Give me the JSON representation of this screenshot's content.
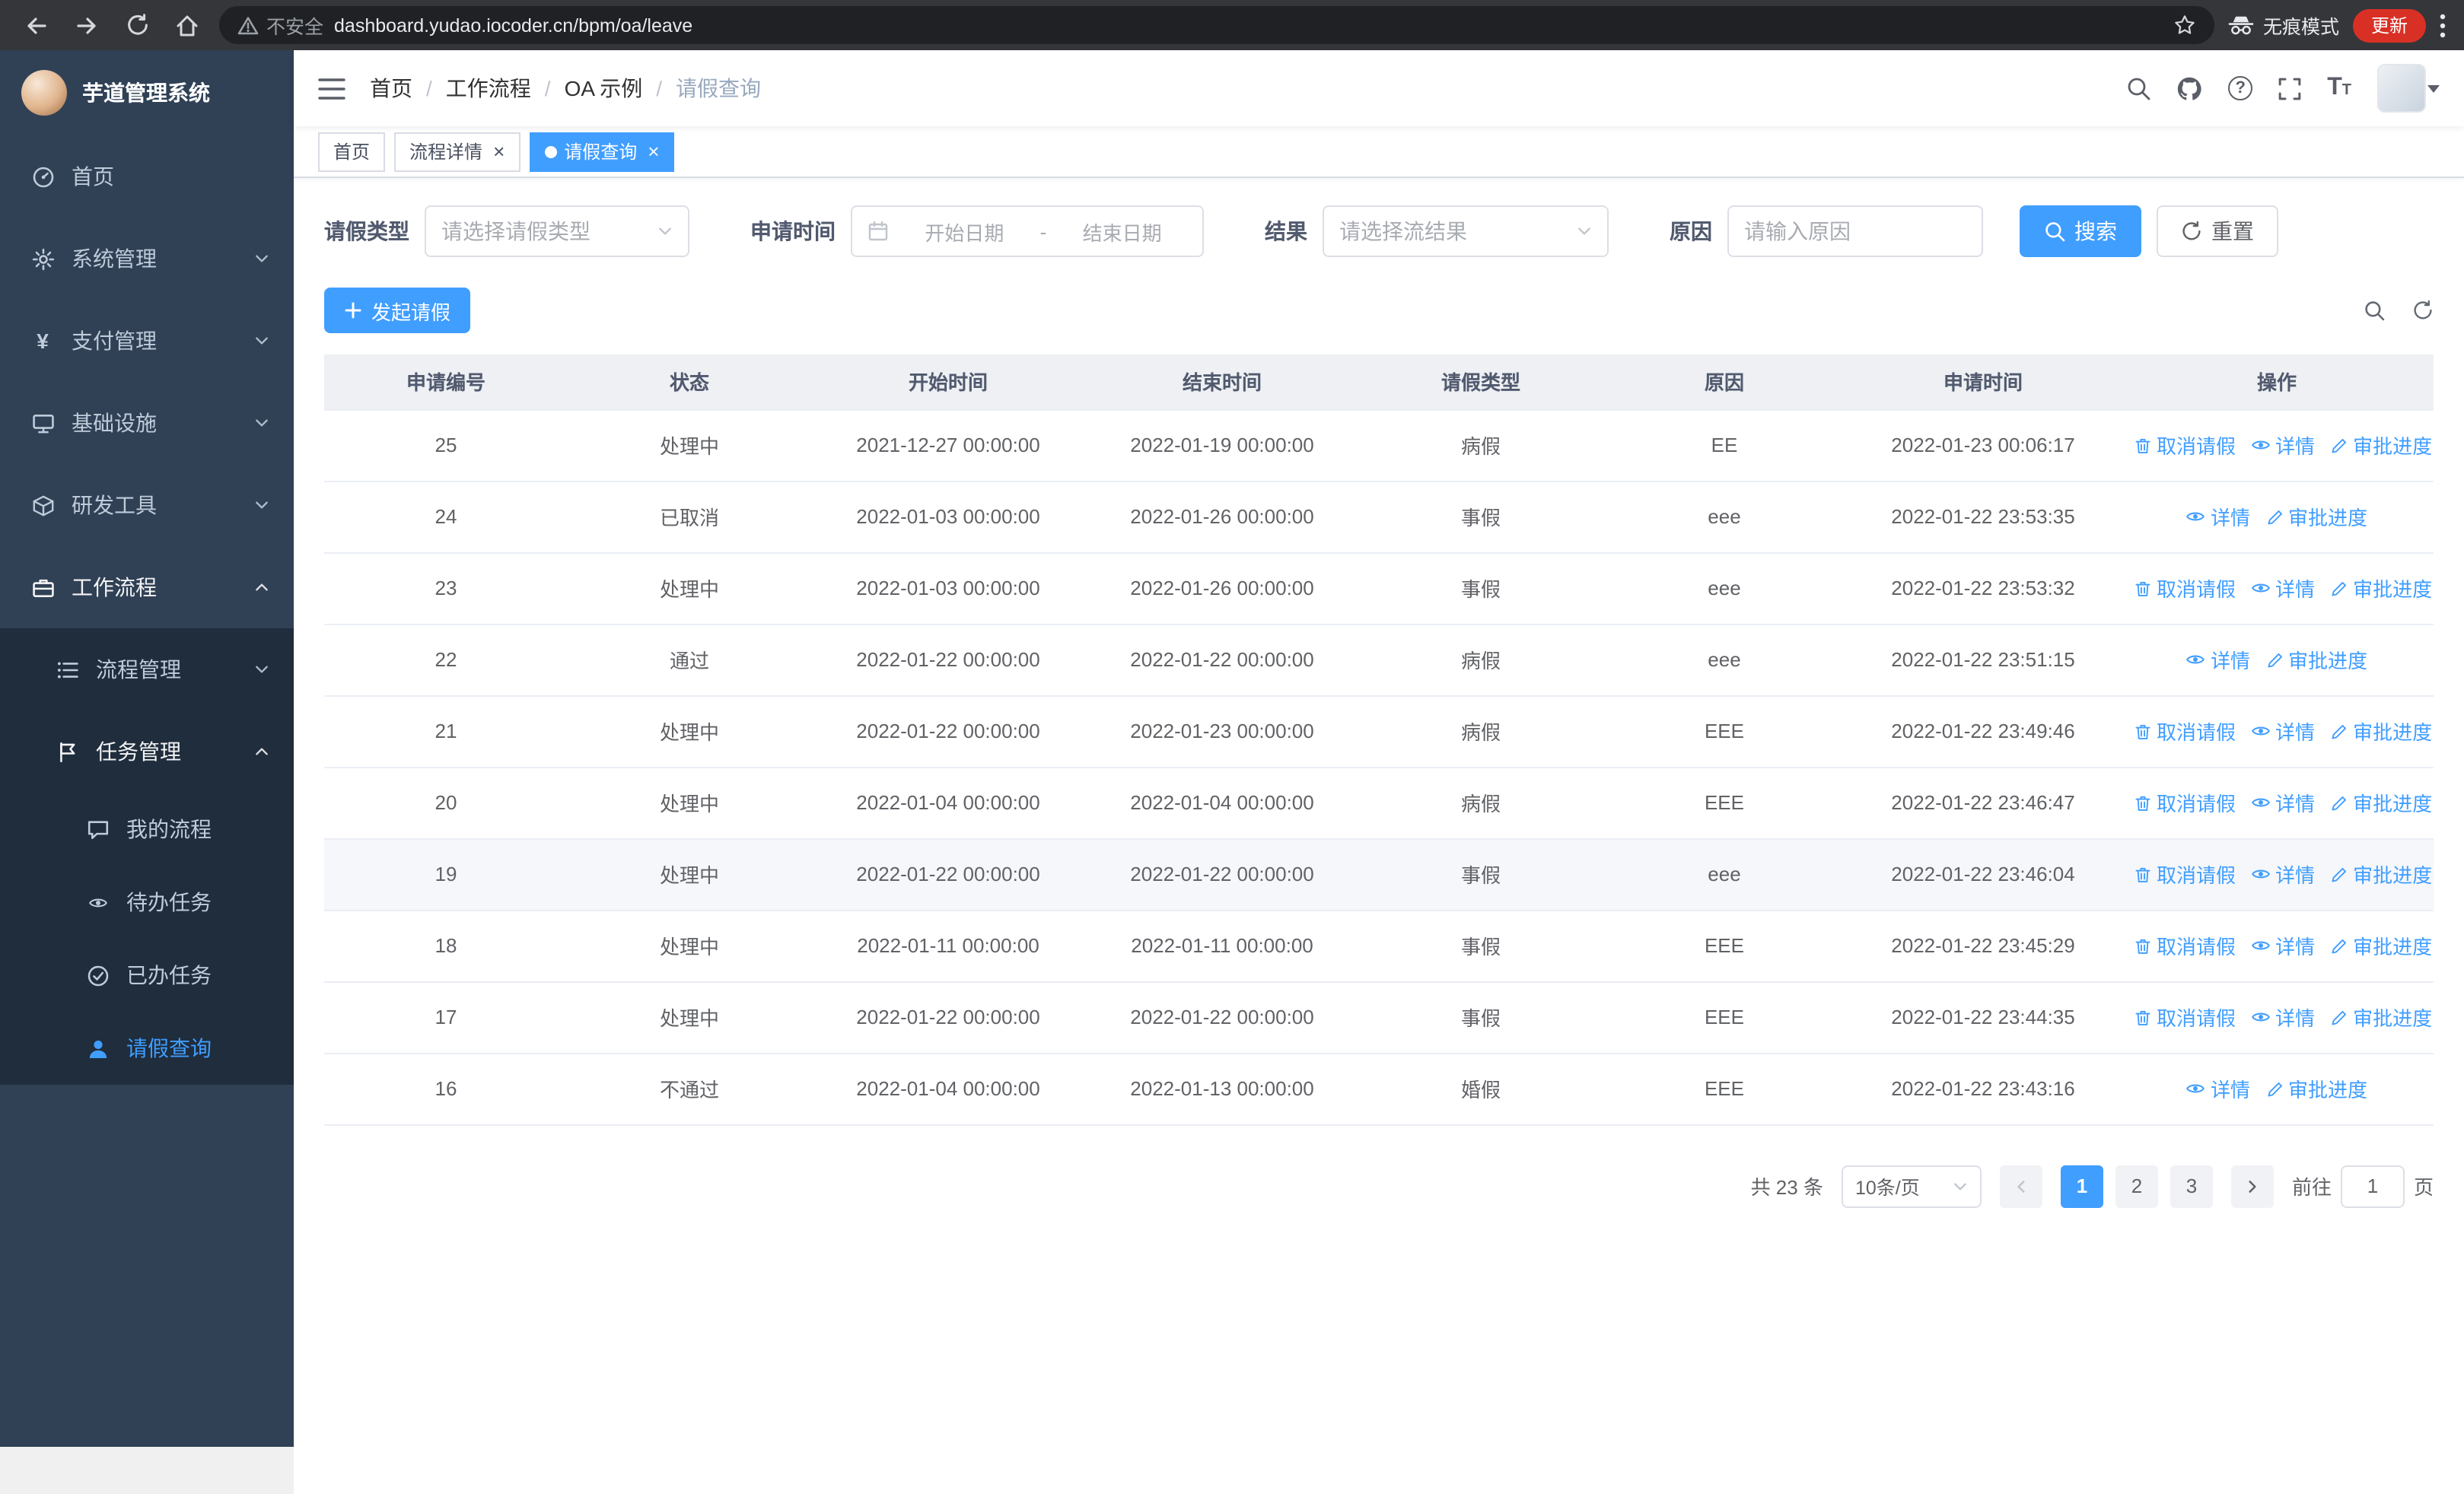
{
  "colors": {
    "accent": "#409eff",
    "sidebar_bg": "#304156",
    "submenu_bg": "#1f2d3d",
    "update_pill": "#d93025",
    "table_header_bg": "#eef0f4"
  },
  "browser": {
    "security_warning": "不安全",
    "url": "dashboard.yudao.iocoder.cn/bpm/oa/leave",
    "incognito_label": "无痕模式",
    "update_label": "更新"
  },
  "sidebar": {
    "app_title": "芋道管理系统",
    "items": [
      {
        "label": "首页",
        "level": 1,
        "icon": "dashboard-icon",
        "expandable": false,
        "expanded": false,
        "active": false
      },
      {
        "label": "系统管理",
        "level": 1,
        "icon": "gear-icon",
        "expandable": true,
        "expanded": false,
        "active": false
      },
      {
        "label": "支付管理",
        "level": 1,
        "icon": "yen-icon",
        "expandable": true,
        "expanded": false,
        "active": false
      },
      {
        "label": "基础设施",
        "level": 1,
        "icon": "monitor-icon",
        "expandable": true,
        "expanded": false,
        "active": false
      },
      {
        "label": "研发工具",
        "level": 1,
        "icon": "cube-icon",
        "expandable": true,
        "expanded": false,
        "active": false
      },
      {
        "label": "工作流程",
        "level": 1,
        "icon": "briefcase-icon",
        "expandable": true,
        "expanded": true,
        "active": false
      },
      {
        "label": "流程管理",
        "level": 2,
        "icon": "list-icon",
        "expandable": true,
        "expanded": false,
        "active": false
      },
      {
        "label": "任务管理",
        "level": 2,
        "icon": "flag-icon",
        "expandable": true,
        "expanded": true,
        "active": false
      },
      {
        "label": "我的流程",
        "level": 3,
        "icon": "chat-icon",
        "expandable": false,
        "expanded": false,
        "active": false
      },
      {
        "label": "待办任务",
        "level": 3,
        "icon": "eye-icon",
        "expandable": false,
        "expanded": false,
        "active": false
      },
      {
        "label": "已办任务",
        "level": 3,
        "icon": "check-circle-icon",
        "expandable": false,
        "expanded": false,
        "active": false
      },
      {
        "label": "请假查询",
        "level": 3,
        "icon": "user-icon",
        "expandable": false,
        "expanded": false,
        "active": true
      }
    ]
  },
  "header": {
    "breadcrumb": [
      "首页",
      "工作流程",
      "OA 示例",
      "请假查询"
    ]
  },
  "tabs": [
    {
      "label": "首页",
      "closable": false,
      "active": false
    },
    {
      "label": "流程详情",
      "closable": true,
      "active": false
    },
    {
      "label": "请假查询",
      "closable": true,
      "active": true
    }
  ],
  "filters": {
    "leave_type_label": "请假类型",
    "leave_type_placeholder": "请选择请假类型",
    "apply_time_label": "申请时间",
    "start_date_placeholder": "开始日期",
    "range_separator": "-",
    "end_date_placeholder": "结束日期",
    "result_label": "结果",
    "result_placeholder": "请选择流结果",
    "reason_label": "原因",
    "reason_placeholder": "请输入原因",
    "search_button": "搜索",
    "reset_button": "重置"
  },
  "toolbar": {
    "create_button": "发起请假"
  },
  "table": {
    "columns": [
      "申请编号",
      "状态",
      "开始时间",
      "结束时间",
      "请假类型",
      "原因",
      "申请时间",
      "操作"
    ],
    "action_meta": {
      "取消请假": {
        "icon": "trash-icon",
        "name": "cancel-leave-link"
      },
      "详情": {
        "icon": "eye-icon",
        "name": "detail-link"
      },
      "审批进度": {
        "icon": "edit-icon",
        "name": "approval-progress-link"
      }
    },
    "rows": [
      {
        "id": "25",
        "status": "处理中",
        "start": "2021-12-27 00:00:00",
        "end": "2022-01-19 00:00:00",
        "type": "病假",
        "reason": "EE",
        "apply": "2022-01-23 00:06:17",
        "actions": [
          "取消请假",
          "详情",
          "审批进度"
        ],
        "hovered": false
      },
      {
        "id": "24",
        "status": "已取消",
        "start": "2022-01-03 00:00:00",
        "end": "2022-01-26 00:00:00",
        "type": "事假",
        "reason": "eee",
        "apply": "2022-01-22 23:53:35",
        "actions": [
          "详情",
          "审批进度"
        ],
        "hovered": false
      },
      {
        "id": "23",
        "status": "处理中",
        "start": "2022-01-03 00:00:00",
        "end": "2022-01-26 00:00:00",
        "type": "事假",
        "reason": "eee",
        "apply": "2022-01-22 23:53:32",
        "actions": [
          "取消请假",
          "详情",
          "审批进度"
        ],
        "hovered": false
      },
      {
        "id": "22",
        "status": "通过",
        "start": "2022-01-22 00:00:00",
        "end": "2022-01-22 00:00:00",
        "type": "病假",
        "reason": "eee",
        "apply": "2022-01-22 23:51:15",
        "actions": [
          "详情",
          "审批进度"
        ],
        "hovered": false
      },
      {
        "id": "21",
        "status": "处理中",
        "start": "2022-01-22 00:00:00",
        "end": "2022-01-23 00:00:00",
        "type": "病假",
        "reason": "EEE",
        "apply": "2022-01-22 23:49:46",
        "actions": [
          "取消请假",
          "详情",
          "审批进度"
        ],
        "hovered": false
      },
      {
        "id": "20",
        "status": "处理中",
        "start": "2022-01-04 00:00:00",
        "end": "2022-01-04 00:00:00",
        "type": "病假",
        "reason": "EEE",
        "apply": "2022-01-22 23:46:47",
        "actions": [
          "取消请假",
          "详情",
          "审批进度"
        ],
        "hovered": false
      },
      {
        "id": "19",
        "status": "处理中",
        "start": "2022-01-22 00:00:00",
        "end": "2022-01-22 00:00:00",
        "type": "事假",
        "reason": "eee",
        "apply": "2022-01-22 23:46:04",
        "actions": [
          "取消请假",
          "详情",
          "审批进度"
        ],
        "hovered": true
      },
      {
        "id": "18",
        "status": "处理中",
        "start": "2022-01-11 00:00:00",
        "end": "2022-01-11 00:00:00",
        "type": "事假",
        "reason": "EEE",
        "apply": "2022-01-22 23:45:29",
        "actions": [
          "取消请假",
          "详情",
          "审批进度"
        ],
        "hovered": false
      },
      {
        "id": "17",
        "status": "处理中",
        "start": "2022-01-22 00:00:00",
        "end": "2022-01-22 00:00:00",
        "type": "事假",
        "reason": "EEE",
        "apply": "2022-01-22 23:44:35",
        "actions": [
          "取消请假",
          "详情",
          "审批进度"
        ],
        "hovered": false
      },
      {
        "id": "16",
        "status": "不通过",
        "start": "2022-01-04 00:00:00",
        "end": "2022-01-13 00:00:00",
        "type": "婚假",
        "reason": "EEE",
        "apply": "2022-01-22 23:43:16",
        "actions": [
          "详情",
          "审批进度"
        ],
        "hovered": false
      }
    ]
  },
  "pagination": {
    "total_text": "共 23 条",
    "page_size": "10条/页",
    "pages": [
      "1",
      "2",
      "3"
    ],
    "active_page": "1",
    "goto_label": "前往",
    "goto_value": "1",
    "page_label": "页"
  }
}
